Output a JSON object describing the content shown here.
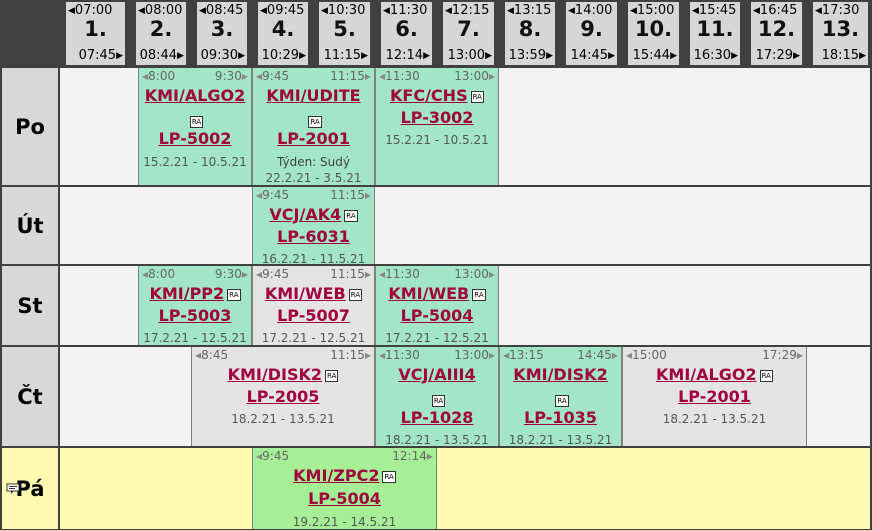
{
  "header": {
    "periods": [
      {
        "start": "07:00",
        "num": "1.",
        "end": "07:45"
      },
      {
        "start": "08:00",
        "num": "2.",
        "end": "08:44"
      },
      {
        "start": "08:45",
        "num": "3.",
        "end": "09:30"
      },
      {
        "start": "09:45",
        "num": "4.",
        "end": "10:29"
      },
      {
        "start": "10:30",
        "num": "5.",
        "end": "11:15"
      },
      {
        "start": "11:30",
        "num": "6.",
        "end": "12:14"
      },
      {
        "start": "12:15",
        "num": "7.",
        "end": "13:00"
      },
      {
        "start": "13:15",
        "num": "8.",
        "end": "13:59"
      },
      {
        "start": "14:00",
        "num": "9.",
        "end": "14:45"
      },
      {
        "start": "15:00",
        "num": "10.",
        "end": "15:44"
      },
      {
        "start": "15:45",
        "num": "11.",
        "end": "16:30"
      },
      {
        "start": "16:45",
        "num": "12.",
        "end": "17:29"
      },
      {
        "start": "17:30",
        "num": "13.",
        "end": "18:15"
      }
    ]
  },
  "days": [
    {
      "label": "Po"
    },
    {
      "label": "Út"
    },
    {
      "label": "St"
    },
    {
      "label": "Čt"
    },
    {
      "label": "Pá"
    }
  ],
  "ra_label": "RA",
  "lessons": {
    "po1": {
      "from": "8:00",
      "to": "9:30",
      "subject": "KMI/ALGO2",
      "room": "LP-5002",
      "dates": "15.2.21 - 10.5.21"
    },
    "po2": {
      "from": "9:45",
      "to": "11:15",
      "subject": "KMI/UDITE",
      "room": "LP-2001",
      "week": "Týden: Sudý",
      "dates": "22.2.21 - 3.5.21"
    },
    "po3": {
      "from": "11:30",
      "to": "13:00",
      "subject": "KFC/CHS",
      "room": "LP-3002",
      "dates": "15.2.21 - 10.5.21"
    },
    "ut1": {
      "from": "9:45",
      "to": "11:15",
      "subject": "VCJ/AK4",
      "room": "LP-6031",
      "dates": "16.2.21 - 11.5.21"
    },
    "st1": {
      "from": "8:00",
      "to": "9:30",
      "subject": "KMI/PP2",
      "room": "LP-5003",
      "dates": "17.2.21 - 12.5.21"
    },
    "st2": {
      "from": "9:45",
      "to": "11:15",
      "subject": "KMI/WEB",
      "room": "LP-5007",
      "dates": "17.2.21 - 12.5.21"
    },
    "st3": {
      "from": "11:30",
      "to": "13:00",
      "subject": "KMI/WEB",
      "room": "LP-5004",
      "dates": "17.2.21 - 12.5.21"
    },
    "ct1": {
      "from": "8:45",
      "to": "11:15",
      "subject": "KMI/DISK2",
      "room": "LP-2005",
      "dates": "18.2.21 - 13.5.21"
    },
    "ct2": {
      "from": "11:30",
      "to": "13:00",
      "subject": "VCJ/AIII4",
      "room": "LP-1028",
      "dates": "18.2.21 - 13.5.21"
    },
    "ct3": {
      "from": "13:15",
      "to": "14:45",
      "subject": "KMI/DISK2",
      "room": "LP-1035",
      "dates": "18.2.21 - 13.5.21"
    },
    "ct4": {
      "from": "15:00",
      "to": "17:29",
      "subject": "KMI/ALGO2",
      "room": "LP-2001",
      "dates": "18.2.21 - 13.5.21"
    },
    "pa1": {
      "from": "9:45",
      "to": "12:14",
      "subject": "KMI/ZPC2",
      "room": "LP-5004",
      "dates": "19.2.21 - 14.5.21"
    }
  },
  "colors": {
    "lesson_green": "#a2e6c7",
    "lesson_gray": "#e4e4e4",
    "lesson_friday": "#a6ef97",
    "friday_bg": "#fffbb0",
    "link": "#a0003c"
  },
  "icons": {
    "friday_marker": "note-icon",
    "prev_arrow": "triangle-left-icon",
    "next_arrow": "triangle-right-icon"
  }
}
